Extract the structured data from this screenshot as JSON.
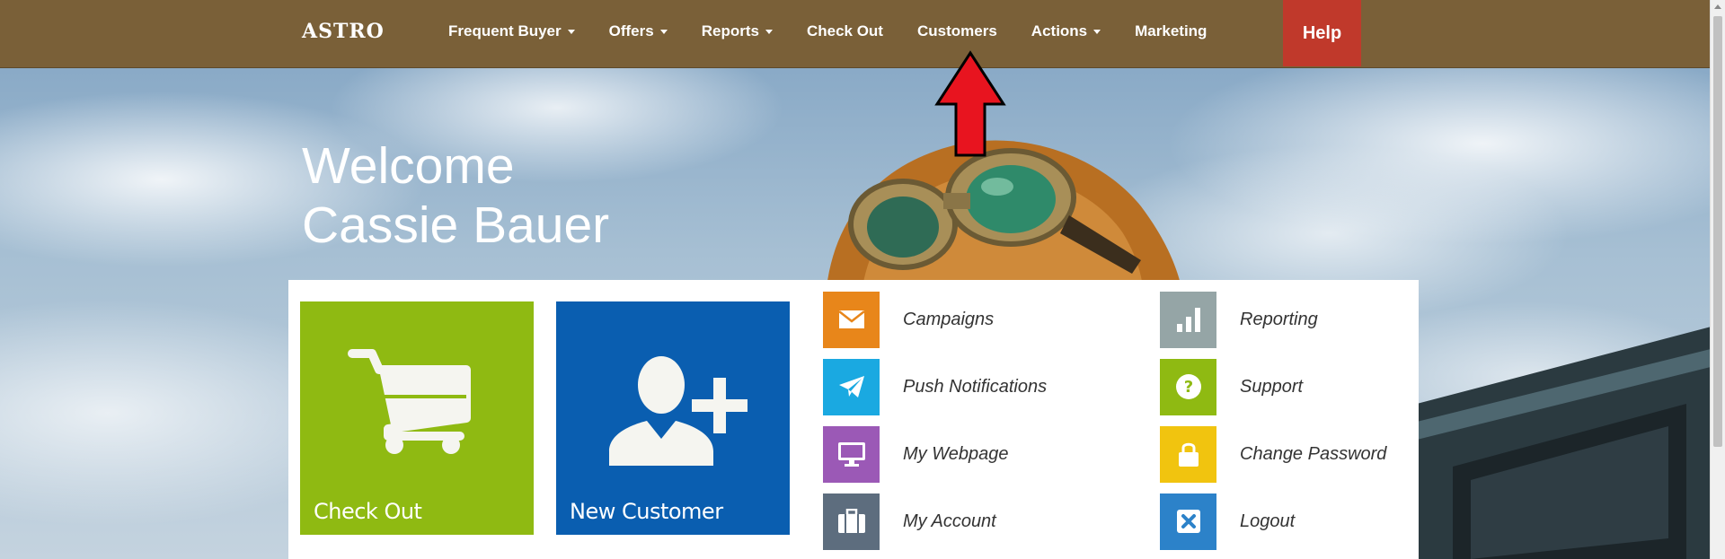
{
  "brand": "ASTRO",
  "nav": {
    "items": [
      {
        "label": "Frequent Buyer",
        "dropdown": true
      },
      {
        "label": "Offers",
        "dropdown": true
      },
      {
        "label": "Reports",
        "dropdown": true
      },
      {
        "label": "Check Out",
        "dropdown": false
      },
      {
        "label": "Customers",
        "dropdown": false
      },
      {
        "label": "Actions",
        "dropdown": true
      },
      {
        "label": "Marketing",
        "dropdown": false
      }
    ],
    "help_label": "Help"
  },
  "welcome": {
    "line1": "Welcome",
    "line2": "Cassie Bauer"
  },
  "tiles": {
    "checkout_label": "Check Out",
    "new_customer_label": "New Customer"
  },
  "links_col1": [
    {
      "label": "Campaigns",
      "icon": "envelope-icon",
      "color": "#e8861a"
    },
    {
      "label": "Push Notifications",
      "icon": "paper-plane-icon",
      "color": "#1aa9e1"
    },
    {
      "label": "My Webpage",
      "icon": "monitor-icon",
      "color": "#9b59b6"
    },
    {
      "label": "My Account",
      "icon": "briefcase-icon",
      "color": "#5d6d7e"
    }
  ],
  "links_col2": [
    {
      "label": "Reporting",
      "icon": "bar-chart-icon",
      "color": "#95a5a6"
    },
    {
      "label": "Support",
      "icon": "question-icon",
      "color": "#8fba12"
    },
    {
      "label": "Change Password",
      "icon": "lock-icon",
      "color": "#f1c40f"
    },
    {
      "label": "Logout",
      "icon": "close-box-icon",
      "color": "#2c82c9"
    }
  ],
  "colors": {
    "navbar": "#7a6038",
    "help": "#c0392b",
    "checkout_tile": "#8fba12",
    "new_customer_tile": "#0a5eb0",
    "arrow": "#e8141f"
  }
}
